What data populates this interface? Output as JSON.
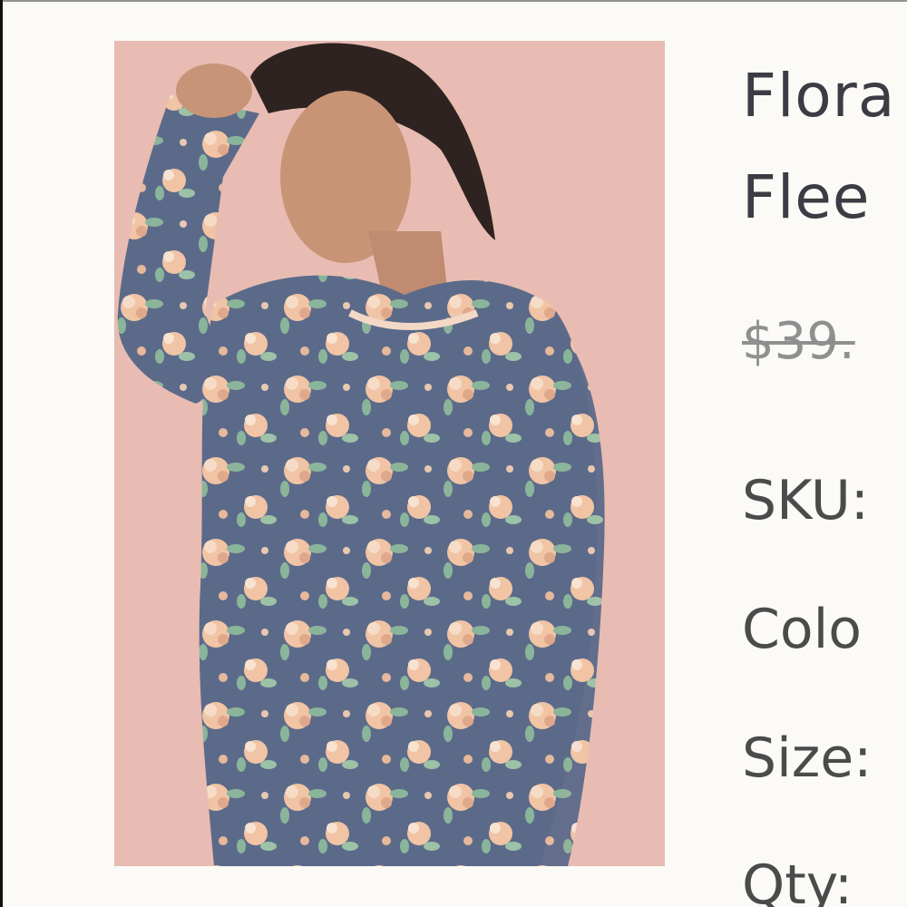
{
  "product": {
    "title_line_1": "Flora",
    "title_line_2": "Flee",
    "price": "$39.",
    "sku_label": "SKU:",
    "color_label": "Colo",
    "size_label": "Size:",
    "qty_label": "Qty:",
    "image_alt": "model wearing floral fleece top"
  },
  "colors": {
    "background": "#fbfaf6",
    "image_backdrop": "#e8bcb2",
    "garment_navy": "#5c6a8a",
    "flower_peach": "#f0c4a4",
    "leaf_green": "#8bb59a",
    "text_dark": "#3b3c44",
    "price_grey": "#8f8f8f"
  }
}
